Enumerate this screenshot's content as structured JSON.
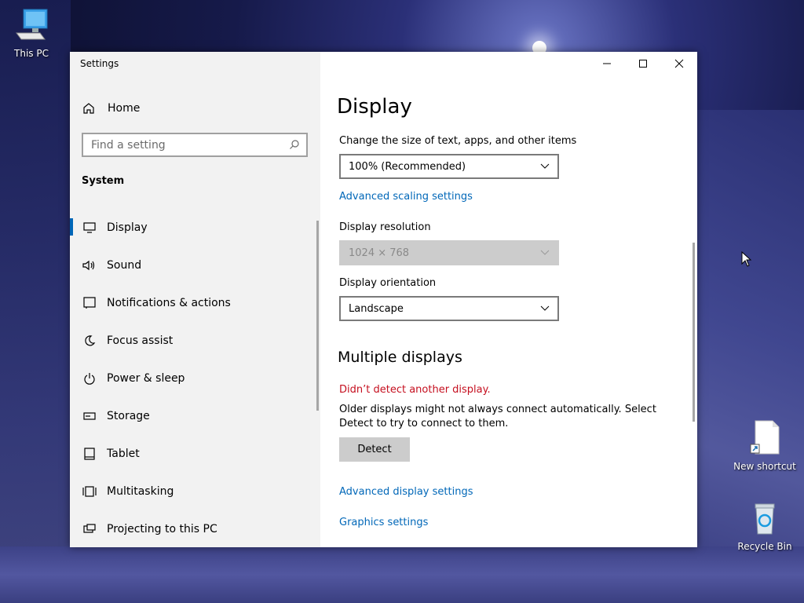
{
  "desktop": {
    "icons": [
      {
        "label": "This PC"
      },
      {
        "label": "New shortcut"
      },
      {
        "label": "Recycle Bin"
      }
    ]
  },
  "window": {
    "title": "Settings",
    "caption": {
      "minimize": "minimize",
      "maximize": "maximize",
      "close": "close"
    }
  },
  "sidebar": {
    "home_label": "Home",
    "search_placeholder": "Find a setting",
    "section_label": "System",
    "items": [
      {
        "label": "Display",
        "icon": "monitor-icon",
        "active": true
      },
      {
        "label": "Sound",
        "icon": "speaker-icon"
      },
      {
        "label": "Notifications & actions",
        "icon": "notification-icon"
      },
      {
        "label": "Focus assist",
        "icon": "moon-icon"
      },
      {
        "label": "Power & sleep",
        "icon": "power-icon"
      },
      {
        "label": "Storage",
        "icon": "storage-icon"
      },
      {
        "label": "Tablet",
        "icon": "tablet-icon"
      },
      {
        "label": "Multitasking",
        "icon": "multitasking-icon"
      },
      {
        "label": "Projecting to this PC",
        "icon": "projecting-icon"
      }
    ]
  },
  "content": {
    "title": "Display",
    "scale": {
      "label": "Change the size of text, apps, and other items",
      "value": "100% (Recommended)"
    },
    "advanced_scaling_link": "Advanced scaling settings",
    "resolution": {
      "label": "Display resolution",
      "value": "1024 × 768",
      "disabled": true
    },
    "orientation": {
      "label": "Display orientation",
      "value": "Landscape"
    },
    "multiple_displays": {
      "heading": "Multiple displays",
      "warning": "Didn’t detect another display.",
      "description": "Older displays might not always connect automatically. Select Detect to try to connect to them.",
      "detect_button": "Detect"
    },
    "advanced_display_link": "Advanced display settings",
    "graphics_link": "Graphics settings"
  },
  "colors": {
    "accent": "#0067b8",
    "warning": "#c50f1f",
    "sidebar_bg": "#f2f2f2"
  }
}
